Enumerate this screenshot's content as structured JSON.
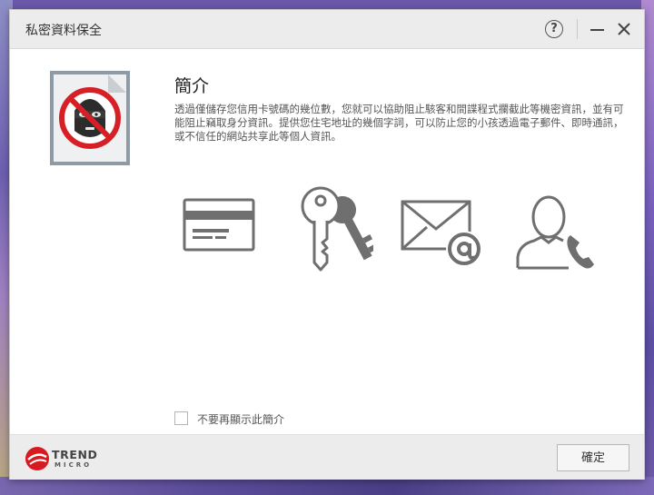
{
  "window": {
    "title": "私密資料保全"
  },
  "titlebar": {
    "help_label": "?"
  },
  "intro": {
    "heading": "簡介",
    "description": "透過僅儲存您信用卡號碼的幾位數，您就可以協助阻止駭客和間諜程式攔截此等機密資訊，並有可能阻止竊取身分資訊。提供您住宅地址的幾個字詞，可以防止您的小孩透過電子郵件、即時通訊，或不信任的網站共享此等個人資訊。"
  },
  "options": {
    "dont_show_label": "不要再顯示此簡介",
    "dont_show_checked": false
  },
  "footer": {
    "brand_line1": "TREND",
    "brand_line2": "MICRO",
    "ok_label": "確定"
  },
  "colors": {
    "brand_red": "#d71920",
    "icon_gray": "#6f6f6f"
  }
}
